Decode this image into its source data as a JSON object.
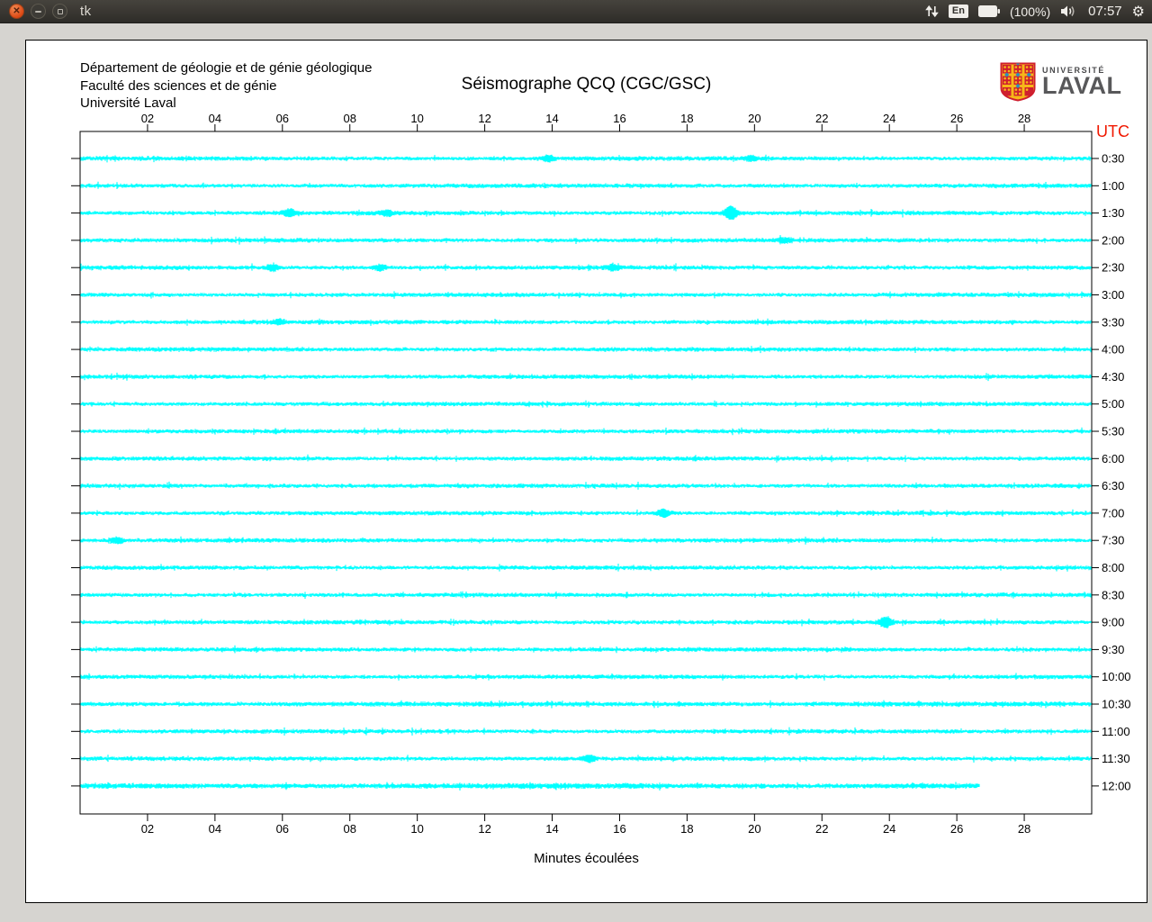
{
  "taskbar": {
    "window_title": "tk",
    "close_glyph": "✕",
    "keyboard_layout": "En",
    "battery_label": "(100%)",
    "clock": "07:57"
  },
  "header": {
    "lines": [
      "Département de géologie et de génie géologique",
      "Faculté des sciences et de génie",
      "Université Laval"
    ],
    "title": "Séismographe QCQ (CGC/GSC)",
    "logo": {
      "small_text": "UNIVERSITÉ",
      "large_text": "LAVAL"
    }
  },
  "chart": {
    "type": "seismogram-helicorder",
    "x_axis": {
      "label": "Minutes écoulées",
      "ticks": [
        "02",
        "04",
        "06",
        "08",
        "10",
        "12",
        "14",
        "16",
        "18",
        "20",
        "22",
        "24",
        "26",
        "28"
      ],
      "range_minutes": [
        0,
        30
      ]
    },
    "right_axis_label": "UTC",
    "colors": {
      "trace": "#00ffff",
      "utc_label": "#f01800",
      "axis": "#000000"
    },
    "rows": [
      {
        "utc": "0:30",
        "events": [
          [
            13.9,
            2.2
          ],
          [
            19.9,
            2.0
          ]
        ]
      },
      {
        "utc": "1:00",
        "events": []
      },
      {
        "utc": "1:30",
        "events": [
          [
            6.2,
            3.2
          ],
          [
            9.1,
            2.2
          ],
          [
            19.3,
            6.5
          ]
        ]
      },
      {
        "utc": "2:00",
        "events": [
          [
            20.9,
            1.8
          ]
        ]
      },
      {
        "utc": "2:30",
        "events": [
          [
            5.7,
            2.5
          ],
          [
            8.9,
            2.5
          ],
          [
            15.8,
            2.2
          ]
        ]
      },
      {
        "utc": "3:00",
        "events": []
      },
      {
        "utc": "3:30",
        "events": [
          [
            5.9,
            2.0
          ]
        ]
      },
      {
        "utc": "4:00",
        "events": []
      },
      {
        "utc": "4:30",
        "events": []
      },
      {
        "utc": "5:00",
        "events": []
      },
      {
        "utc": "5:30",
        "events": []
      },
      {
        "utc": "6:00",
        "events": []
      },
      {
        "utc": "6:30",
        "events": []
      },
      {
        "utc": "7:00",
        "events": [
          [
            17.3,
            3.5
          ]
        ]
      },
      {
        "utc": "7:30",
        "events": [
          [
            1.1,
            2.5
          ]
        ]
      },
      {
        "utc": "8:00",
        "events": []
      },
      {
        "utc": "8:30",
        "events": []
      },
      {
        "utc": "9:00",
        "events": [
          [
            23.9,
            4.5
          ]
        ]
      },
      {
        "utc": "9:30",
        "events": []
      },
      {
        "utc": "10:00",
        "events": []
      },
      {
        "utc": "10:30",
        "events": [],
        "gain": 1.15
      },
      {
        "utc": "11:00",
        "events": []
      },
      {
        "utc": "11:30",
        "events": [
          [
            15.1,
            2.8
          ]
        ]
      },
      {
        "utc": "12:00",
        "events": [],
        "end_min": 26.7,
        "gain": 1.3
      }
    ]
  }
}
